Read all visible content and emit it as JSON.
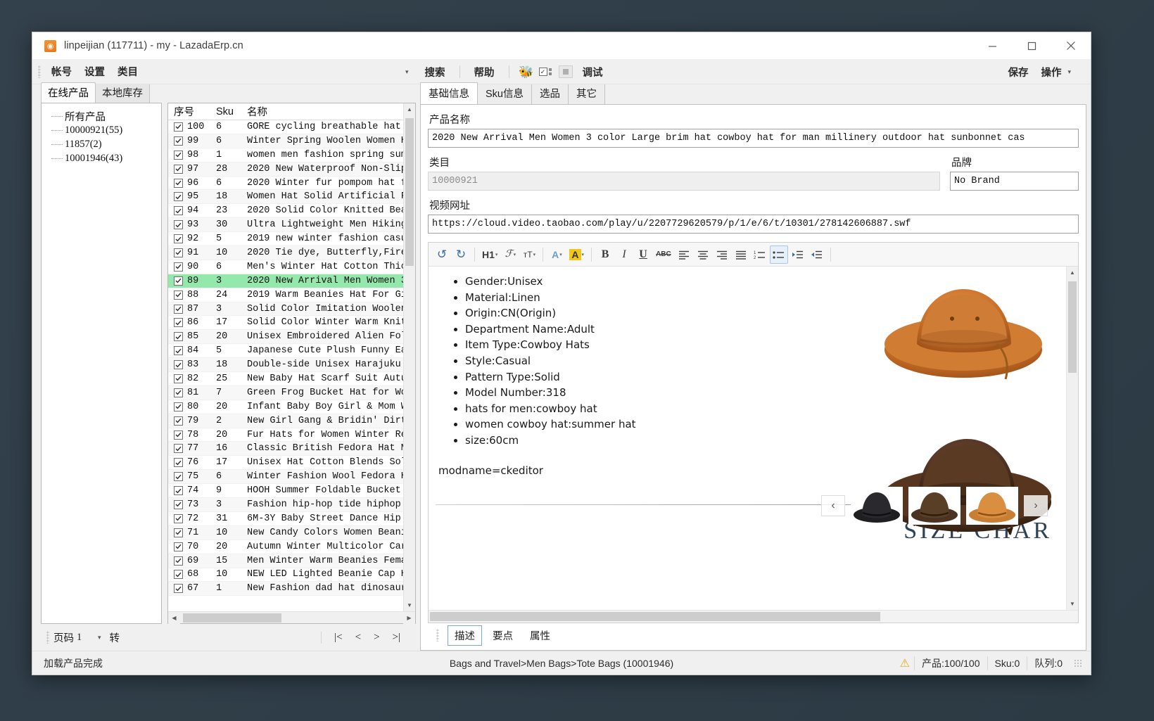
{
  "window": {
    "title": "linpeijian (117711) - my - LazadaErp.cn",
    "app_icon": "app-icon",
    "minimize": "−",
    "maximize": "□",
    "close": "✕"
  },
  "menubar": {
    "items": [
      {
        "label": "帐号",
        "name": "menu-account"
      },
      {
        "label": "设置",
        "name": "menu-settings"
      },
      {
        "label": "类目",
        "name": "menu-category"
      }
    ],
    "dropdown_caret": "▾",
    "search": "搜索",
    "help": "帮助",
    "bee_icon": "🐝",
    "checklist_icon": "checklist-icon",
    "stop_icon": "stop-icon",
    "debug": "调试",
    "save": "保存",
    "operate": "操作",
    "operate_caret": "▾"
  },
  "left": {
    "tabs": [
      {
        "label": "在线产品",
        "active": true
      },
      {
        "label": "本地库存",
        "active": false
      }
    ],
    "tree": [
      {
        "label": "所有产品",
        "cn": true
      },
      {
        "label": "10000921(55)",
        "cn": false
      },
      {
        "label": "11857(2)",
        "cn": false
      },
      {
        "label": "10001946(43)",
        "cn": false
      }
    ],
    "grid_headers": {
      "seq": "序号",
      "sku": "Sku",
      "name": "名称"
    },
    "rows": [
      {
        "seq": "100",
        "sku": "6",
        "name": "GORE cycling breathable hat",
        "checked": true
      },
      {
        "seq": "99",
        "sku": "6",
        "name": "Winter Spring Woolen Women H",
        "checked": true
      },
      {
        "seq": "98",
        "sku": "1",
        "name": "women men fashion spring sum",
        "checked": true
      },
      {
        "seq": "97",
        "sku": "28",
        "name": "2020 New Waterproof Non-Slip",
        "checked": true
      },
      {
        "seq": "96",
        "sku": "6",
        "name": "2020 Winter fur pompom hat f",
        "checked": true
      },
      {
        "seq": "95",
        "sku": "18",
        "name": "Women Hat Solid Artificial F",
        "checked": true
      },
      {
        "seq": "94",
        "sku": "23",
        "name": "2020 Solid Color Knitted Bea",
        "checked": true
      },
      {
        "seq": "93",
        "sku": "30",
        "name": "Ultra Lightweight Men Hiking",
        "checked": true
      },
      {
        "seq": "92",
        "sku": "5",
        "name": "2019 new winter fashion casu",
        "checked": true
      },
      {
        "seq": "91",
        "sku": "10",
        "name": "2020 Tie dye, Butterfly,Fire",
        "checked": true
      },
      {
        "seq": "90",
        "sku": "6",
        "name": "Men's Winter Hat Cotton Thic",
        "checked": true
      },
      {
        "seq": "89",
        "sku": "3",
        "name": "2020 New Arrival Men Women 3",
        "checked": true,
        "selected": true
      },
      {
        "seq": "88",
        "sku": "24",
        "name": "2019 Warm Beanies Hat For Gi",
        "checked": true
      },
      {
        "seq": "87",
        "sku": "3",
        "name": "Solid Color Imitation Woolen",
        "checked": true
      },
      {
        "seq": "86",
        "sku": "17",
        "name": "Solid Color Winter Warm Knit",
        "checked": true
      },
      {
        "seq": "85",
        "sku": "20",
        "name": "Unisex Embroidered Alien Fol",
        "checked": true
      },
      {
        "seq": "84",
        "sku": "5",
        "name": "Japanese Cute Plush Funny Ea",
        "checked": true
      },
      {
        "seq": "83",
        "sku": "18",
        "name": "Double-side Unisex Harajuku",
        "checked": true
      },
      {
        "seq": "82",
        "sku": "25",
        "name": "New Baby Hat Scarf Suit Autu",
        "checked": true
      },
      {
        "seq": "81",
        "sku": "7",
        "name": "Green Frog Bucket Hat for Wo",
        "checked": true
      },
      {
        "seq": "80",
        "sku": "20",
        "name": "Infant Baby Boy Girl & Mom W",
        "checked": true
      },
      {
        "seq": "79",
        "sku": "2",
        "name": "New Girl Gang & Bridin' Dirt",
        "checked": true
      },
      {
        "seq": "78",
        "sku": "20",
        "name": "Fur Hats for Women Winter Re",
        "checked": true
      },
      {
        "seq": "77",
        "sku": "16",
        "name": "Classic British Fedora Hat M",
        "checked": true
      },
      {
        "seq": "76",
        "sku": "17",
        "name": "Unisex Hat Cotton Blends Sol",
        "checked": true
      },
      {
        "seq": "75",
        "sku": "6",
        "name": "Winter Fashion Wool Fedora H",
        "checked": true
      },
      {
        "seq": "74",
        "sku": "9",
        "name": "HOOH Summer Foldable Bucket",
        "checked": true
      },
      {
        "seq": "73",
        "sku": "3",
        "name": "Fashion hip-hop tide hiphop",
        "checked": true
      },
      {
        "seq": "72",
        "sku": "31",
        "name": "6M-3Y Baby Street Dance Hip",
        "checked": true
      },
      {
        "seq": "71",
        "sku": "10",
        "name": "New Candy Colors Women Beani",
        "checked": true
      },
      {
        "seq": "70",
        "sku": "20",
        "name": "Autumn Winter Multicolor Car",
        "checked": true
      },
      {
        "seq": "69",
        "sku": "15",
        "name": "Men Winter Warm Beanies Fema",
        "checked": true
      },
      {
        "seq": "68",
        "sku": "10",
        "name": "NEW LED Lighted Beanie Cap H",
        "checked": true
      },
      {
        "seq": "67",
        "sku": "1",
        "name": "New Fashion dad hat dinosaur",
        "checked": true
      }
    ],
    "pager": {
      "label": "页码",
      "value": "1",
      "caret": "▾",
      "go": "转",
      "first": "|<",
      "prev": "<",
      "next": ">",
      "last": ">|"
    }
  },
  "right": {
    "tabs": [
      {
        "label": "基础信息",
        "active": true
      },
      {
        "label": "Sku信息",
        "active": false
      },
      {
        "label": "选品",
        "active": false
      },
      {
        "label": "其它",
        "active": false
      }
    ],
    "fields": {
      "product_name_label": "产品名称",
      "product_name_value": "2020 New Arrival Men Women 3 color Large brim hat cowboy hat for man millinery outdoor hat sunbonnet cas",
      "category_label": "类目",
      "category_value": "10000921",
      "brand_label": "品牌",
      "brand_value": "No Brand",
      "video_label": "视频网址",
      "video_value": "https://cloud.video.taobao.com/play/u/2207729620579/p/1/e/6/t/10301/278142606887.swf"
    },
    "editor_toolbar": {
      "undo": "↺",
      "redo": "↻",
      "heading": "H1",
      "font_family": "ℱ",
      "font_size": "тT",
      "text_color": "A",
      "highlight": "A",
      "bold": "B",
      "italic": "I",
      "underline": "U",
      "strikethrough": "ABC",
      "align_left": "align-left",
      "align_center": "align-center",
      "align_right": "align-right",
      "align_justify": "align-justify",
      "ordered_list": "ordered-list",
      "unordered_list": "unordered-list",
      "indent": "indent",
      "outdent": "outdent"
    },
    "editor_content": {
      "bullets": [
        "Gender:Unisex",
        "Material:Linen",
        "Origin:CN(Origin)",
        "Department Name:Adult",
        "Item Type:Cowboy Hats",
        "Style:Casual",
        "Pattern Type:Solid",
        "Model Number:318",
        "hats for men:cowboy hat",
        "women cowboy hat:summer hat",
        "size:60cm"
      ],
      "modname": "modname=ckeditor",
      "size_chart": "SIZE CHAR"
    },
    "gallery": {
      "prev": "‹",
      "next": "›"
    },
    "bottom_tabs": [
      {
        "label": "描述",
        "active": true
      },
      {
        "label": "要点",
        "active": false
      },
      {
        "label": "属性",
        "active": false
      }
    ]
  },
  "statusbar": {
    "left": "加载产品完成",
    "center": "Bags and Travel>Men Bags>Tote Bags (10001946)",
    "warn_icon": "⚠",
    "products": "产品:100/100",
    "sku": "Sku:0",
    "queue": "队列:0"
  },
  "colors": {
    "selected_row": "#95e8ab",
    "accent": "#7aa7d4",
    "highlight_yellow": "#f5c518",
    "warn": "#e8a61c"
  }
}
